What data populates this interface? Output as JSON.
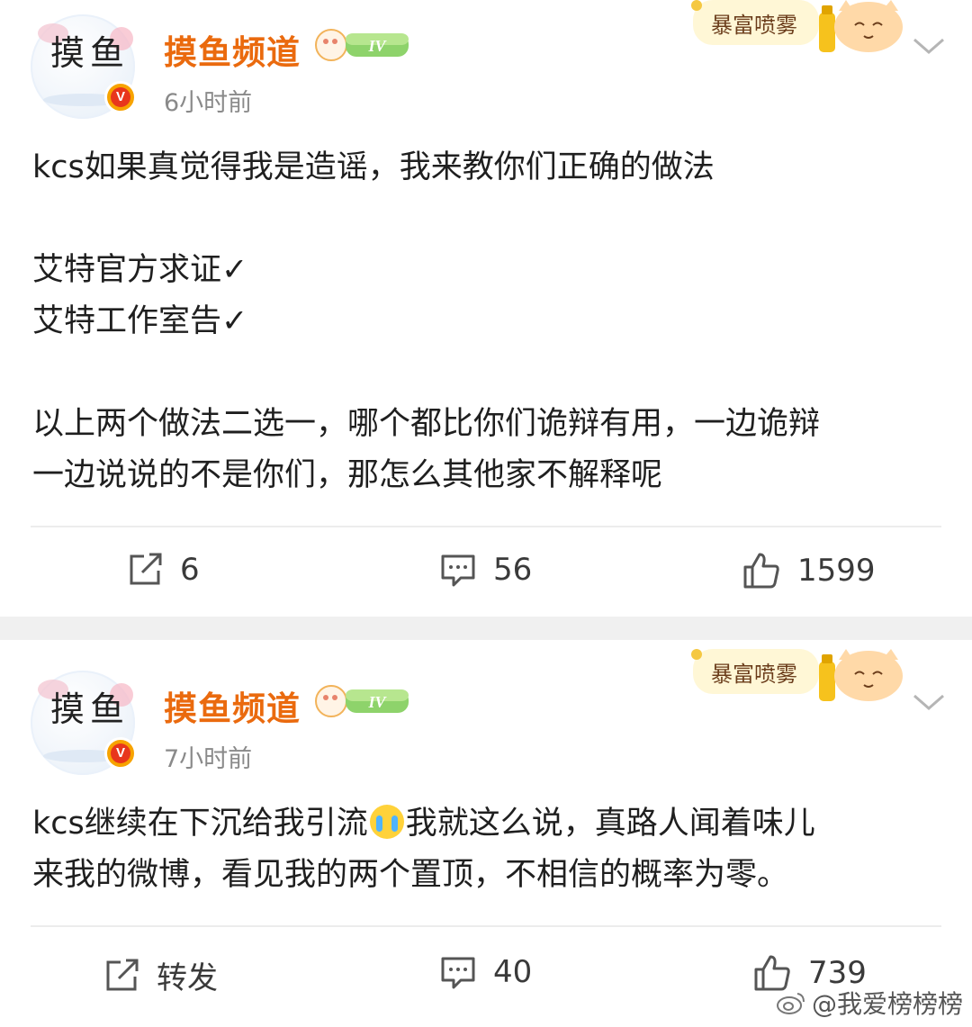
{
  "posts": [
    {
      "author": "摸鱼频道",
      "level": "IV",
      "time": "6小时前",
      "sticker_text": "暴富喷雾",
      "lines": [
        "kcs如果真觉得我是造谣，我来教你们正确的做法",
        "",
        "艾特官方求证✓",
        "艾特工作室告✓",
        "",
        "以上两个做法二选一，哪个都比你们诡辩有用，一边诡辩",
        "一边说说的不是你们，那怎么其他家不解释呢"
      ],
      "repost": "6",
      "comments": "56",
      "likes": "1599"
    },
    {
      "author": "摸鱼频道",
      "level": "IV",
      "time": "7小时前",
      "sticker_text": "暴富喷雾",
      "line1_a": "kcs继续在下沉给我引流",
      "line1_b": "我就这么说，真路人闻着味儿",
      "line2": "来我的微博，看见我的两个置顶，不相信的概率为零。",
      "repost": "转发",
      "comments": "40",
      "likes": "739"
    }
  ],
  "avatar_text": "摸鱼",
  "watermark": "@我爱榜榜榜",
  "colors": {
    "username": "#ea6a0e",
    "vip_badge": "#f7a300",
    "time": "#8a8a8a",
    "divider": "#f0f0f0"
  },
  "icons": [
    "repost-icon",
    "comment-icon",
    "like-icon",
    "chevron-down-icon",
    "verified-badge-icon",
    "weibo-logo-icon",
    "crying-emoji-icon"
  ]
}
